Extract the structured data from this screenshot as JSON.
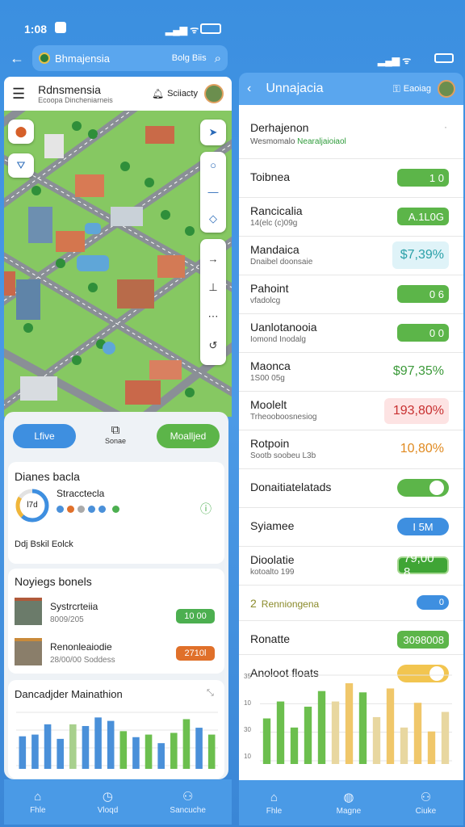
{
  "status": {
    "time": "1:08"
  },
  "left": {
    "search": {
      "text": "Bhmajensia",
      "right": "Bolg Biis"
    },
    "header": {
      "title": "Rdnsmensia",
      "subtitle": "Ecoopa Dincheniarneis",
      "user": "Sciiacty"
    },
    "tabs": [
      "Lfive",
      "Sonae",
      "Moalljed"
    ],
    "card1": {
      "title": "Dianes bacla",
      "subtitle": "Stracctecla",
      "gauge": "l7d",
      "footer": "Ddj Bskil Eolck"
    },
    "card2": {
      "title": "Noyiegs bonels",
      "items": [
        {
          "name": "Systrcrteiia",
          "sub": "8009/205",
          "value": "10 00",
          "color": "#4caf50"
        },
        {
          "name": "Renonleaiodie",
          "sub": "28/00/00 Soddess",
          "value": "2710l",
          "color": "#e0702a"
        }
      ]
    },
    "card3": {
      "title": "Dancadjder Mainathion"
    },
    "chart_data": {
      "type": "bar",
      "values": [
        38,
        40,
        52,
        35,
        52,
        50,
        60,
        56,
        44,
        37,
        40,
        30,
        42,
        58,
        48,
        40
      ],
      "colors": [
        "#4a90d9",
        "#4a90d9",
        "#4a90d9",
        "#4a90d9",
        "#a8d08d",
        "#4a90d9",
        "#4a90d9",
        "#4a90d9",
        "#6cbf4e",
        "#4a90d9",
        "#6cbf4e",
        "#4a90d9",
        "#6cbf4e",
        "#6cbf4e",
        "#4a90d9",
        "#6cbf4e"
      ]
    },
    "nav": [
      "Fhle",
      "Vloqd",
      "Sancuche"
    ]
  },
  "right": {
    "header": {
      "title": "Unnajacia",
      "action": "Eaoiag"
    },
    "section": {
      "title": "Derhajenon",
      "sub": "Wesmomalo",
      "sub_green": "Nearaljaioiaol"
    },
    "rows": [
      {
        "name": "Toibnea",
        "sub": "",
        "value": "1 0",
        "style": "green"
      },
      {
        "name": "Rancicalia",
        "sub": "14(elc (c)09g",
        "value": "A.1L0G",
        "style": "green"
      },
      {
        "name": "Mandaica",
        "sub": "Dnaibel doonsaie",
        "value": "$7,39%",
        "style": "teal-text"
      },
      {
        "name": "Pahoint",
        "sub": "vfadolcg",
        "value": "0 6",
        "style": "green"
      },
      {
        "name": "Uanlotanooia",
        "sub": "Iomond Inodalg",
        "value": "0 0",
        "style": "green"
      },
      {
        "name": "Maonca",
        "sub": "1S00 05g",
        "value": "$97,35%",
        "style": "green-text"
      },
      {
        "name": "Moolelt",
        "sub": "Trheooboosnesiog",
        "value": "193,80%",
        "style": "red-text"
      },
      {
        "name": "Rotpoin",
        "sub": "Sootb soobeu L3b",
        "value": "10,80%",
        "style": "orange-text"
      },
      {
        "name": "Donaitiatelatads",
        "sub": "",
        "value": "",
        "style": "toggle-green"
      },
      {
        "name": "Syiamee",
        "sub": "",
        "value": "I 5M",
        "style": "blue"
      },
      {
        "name": "Dioolatie",
        "sub": "kotoalto 199",
        "value": "79,00 8",
        "style": "green-outline"
      },
      {
        "name": "Renniongena",
        "sub": "",
        "value": "0",
        "style": "blue-small",
        "bullet": "2"
      },
      {
        "name": "Ronatte",
        "sub": "",
        "value": "3098008",
        "style": "green"
      },
      {
        "name": "Anoloot floats",
        "sub": "",
        "value": "",
        "style": "toggle-yellow"
      }
    ],
    "chart_data": {
      "type": "bar",
      "values": [
        35,
        48,
        28,
        44,
        56,
        48,
        62,
        55,
        36,
        58,
        28,
        47,
        25,
        40
      ],
      "colors": [
        "#6cbf4e",
        "#6cbf4e",
        "#6cbf4e",
        "#6cbf4e",
        "#6cbf4e",
        "#e8d7a0",
        "#f0c76a",
        "#6cbf4e",
        "#e8d7a0",
        "#f0c76a",
        "#e8d7a0",
        "#f0c76a",
        "#f0c76a",
        "#e8d7a0"
      ],
      "yticks": [
        "35",
        "10",
        "30",
        "10"
      ]
    },
    "nav": [
      "Fhle",
      "Magne",
      "Ciuke"
    ]
  }
}
